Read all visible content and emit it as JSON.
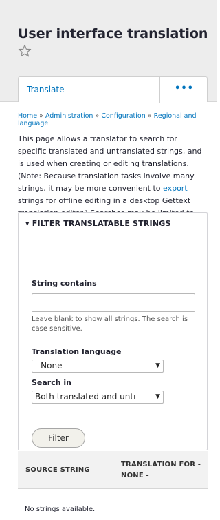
{
  "header": {
    "title": "User interface translation",
    "tabs": [
      {
        "label": "Translate"
      },
      {
        "label": "•••"
      }
    ]
  },
  "breadcrumb": {
    "items": [
      "Home",
      "Administration",
      "Configuration",
      "Regional and language"
    ],
    "separator": "»"
  },
  "description": {
    "part1": "This page allows a translator to search for specific translated and untranslated strings, and is used when creating or editing translations. (Note: Because translation tasks involve many strings, it may be more convenient to ",
    "link": "export",
    "part2": " strings for offline editing in a desktop Gettext translation editor.) Searches may be limited to strings in a specific language."
  },
  "filter": {
    "legend": "FILTER TRANSLATABLE STRINGS",
    "string_contains_label": "String contains",
    "string_contains_value": "",
    "string_contains_help": "Leave blank to show all strings. The search is case sensitive.",
    "translation_language_label": "Translation language",
    "translation_language_value": "- None -",
    "search_in_label": "Search in",
    "search_in_value": "Both translated and untı",
    "filter_button": "Filter"
  },
  "table": {
    "col_source": "SOURCE STRING",
    "col_translation": "TRANSLATION FOR - NONE -",
    "empty_text": "No strings available."
  },
  "colors": {
    "link": "#0074bd",
    "header_bg": "#ededed",
    "text": "#222330"
  }
}
